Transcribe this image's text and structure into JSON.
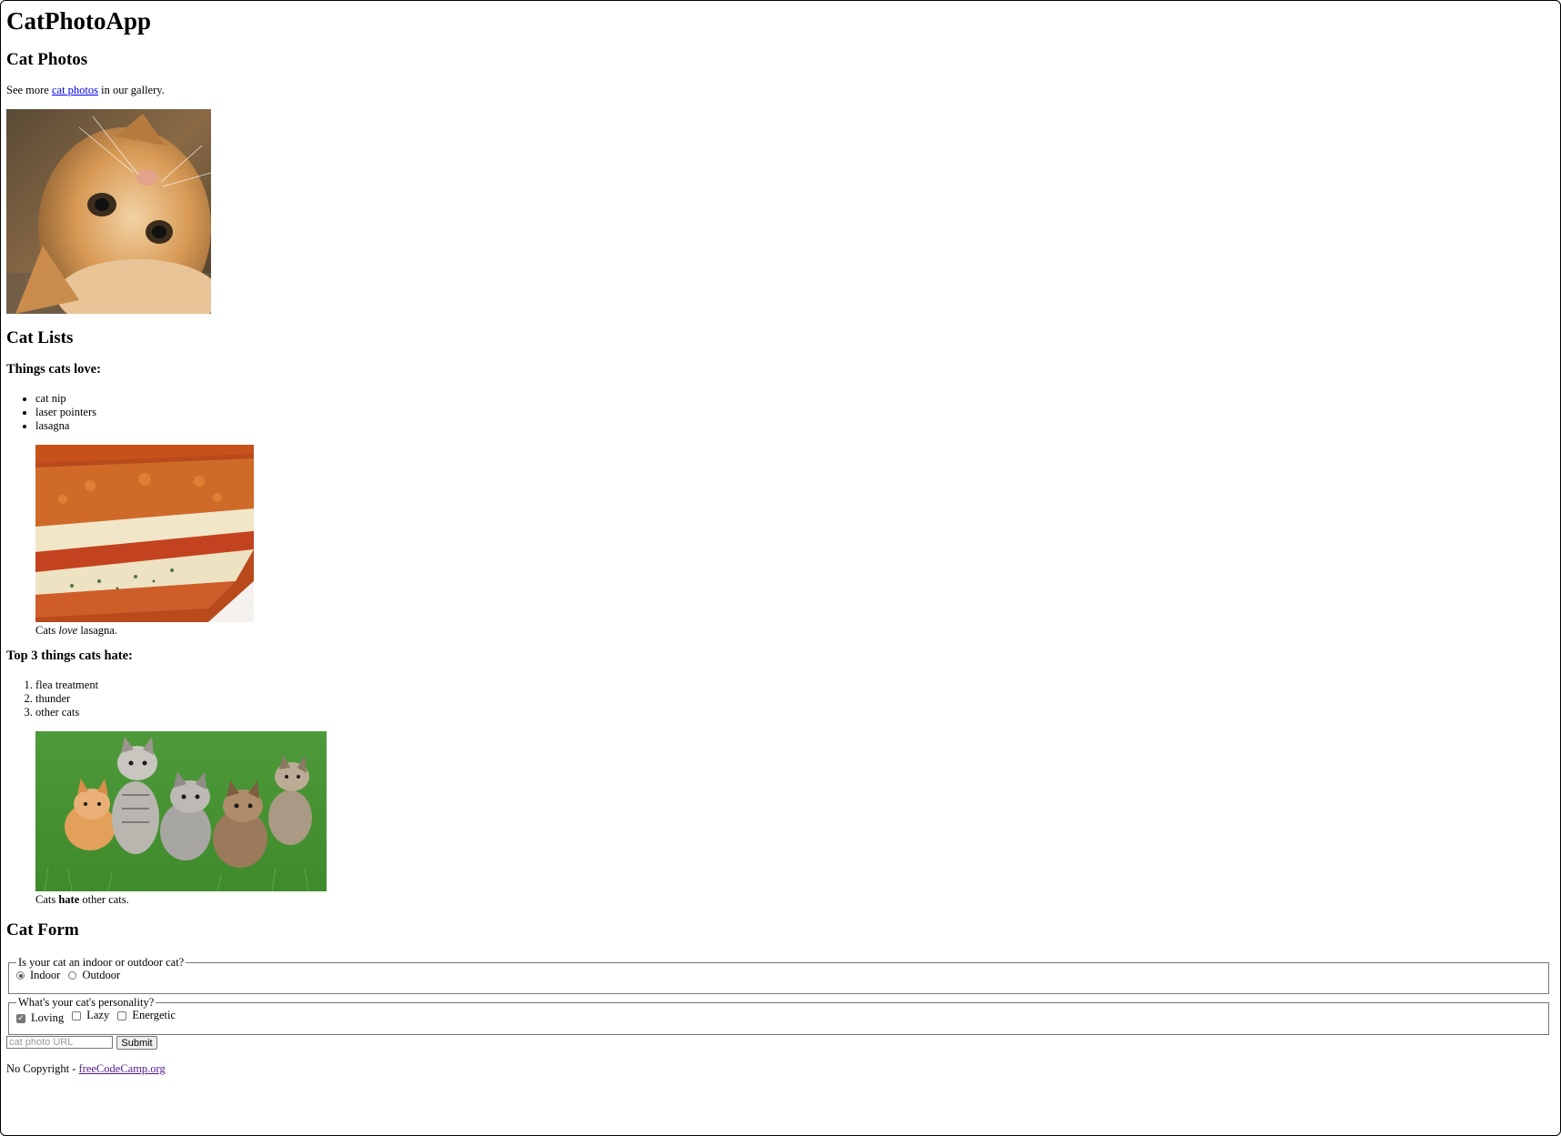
{
  "header": {
    "title": "CatPhotoApp"
  },
  "photos_section": {
    "heading": "Cat Photos",
    "intro_before": "See more ",
    "intro_link": "cat photos",
    "intro_after": " in our gallery.",
    "image_subject": "kitten lying on its back"
  },
  "lists_section": {
    "heading": "Cat Lists",
    "love_heading": "Things cats love:",
    "love_items": [
      "cat nip",
      "laser pointers",
      "lasagna"
    ],
    "love_image_subject": "lasagna slice",
    "love_caption_before": "Cats ",
    "love_caption_emphasis": "love",
    "love_caption_after": " lasagna.",
    "hate_heading": "Top 3 things cats hate:",
    "hate_items": [
      "flea treatment",
      "thunder",
      "other cats"
    ],
    "hate_image_subject": "five kittens on grass",
    "hate_caption_before": "Cats ",
    "hate_caption_strong": "hate",
    "hate_caption_after": " other cats."
  },
  "form_section": {
    "heading": "Cat Form",
    "location_legend": "Is your cat an indoor or outdoor cat?",
    "location_options": [
      {
        "label": "Indoor",
        "checked": true
      },
      {
        "label": "Outdoor",
        "checked": false
      }
    ],
    "personality_legend": "What's your cat's personality?",
    "personality_options": [
      {
        "label": "Loving",
        "checked": true
      },
      {
        "label": "Lazy",
        "checked": false
      },
      {
        "label": "Energetic",
        "checked": false
      }
    ],
    "url_placeholder": "cat photo URL",
    "url_value": "",
    "submit_label": "Submit"
  },
  "footer": {
    "text": "No Copyright - ",
    "link": "freeCodeCamp.org"
  },
  "colors": {
    "link": "#0000ee",
    "visited_link": "#551a8b"
  }
}
